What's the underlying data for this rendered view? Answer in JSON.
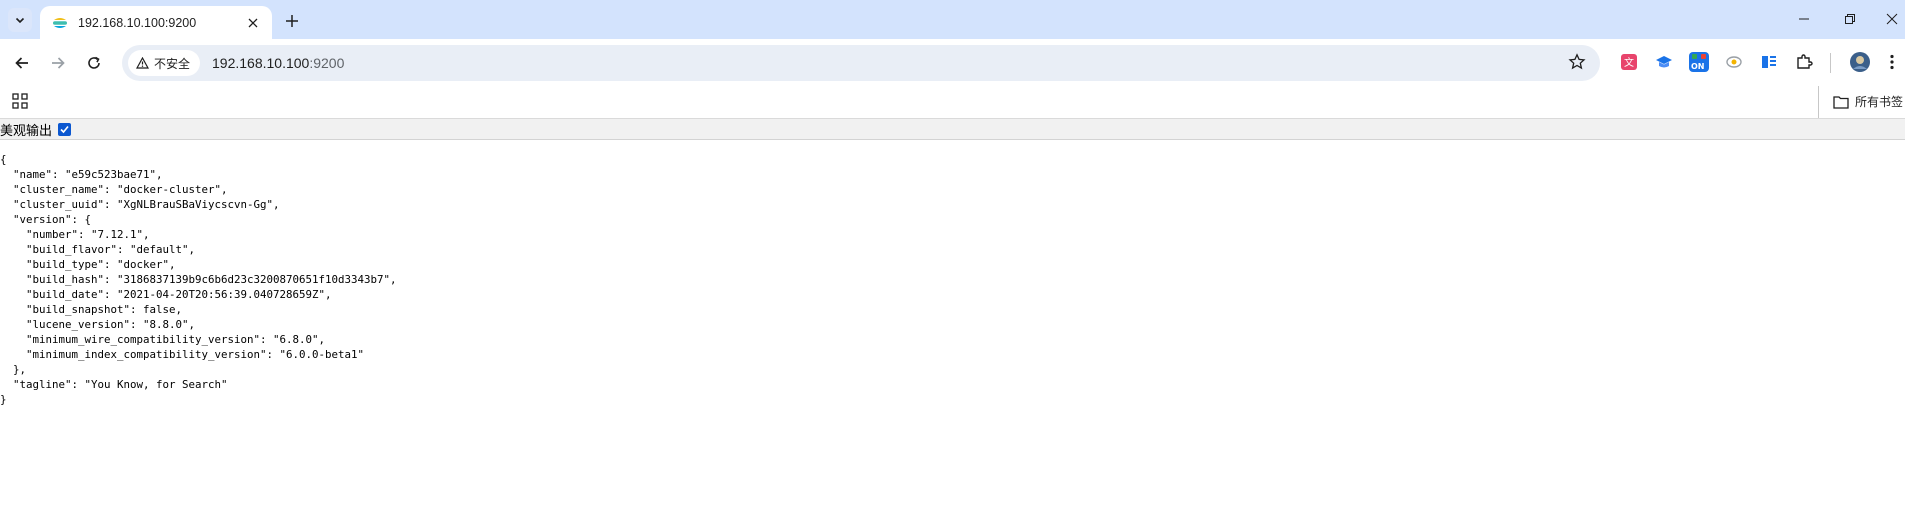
{
  "browser": {
    "tab": {
      "title": "192.168.10.100:9200"
    },
    "address": {
      "security_label": "不安全",
      "host": "192.168.10.100",
      "port": ":9200"
    },
    "bookmarks": {
      "all_label": "所有书签"
    }
  },
  "viewer": {
    "pretty_print_label": "美观输出",
    "pretty_print_checked": true
  },
  "json_lines": [
    "{",
    "  \"name\": \"e59c523bae71\",",
    "  \"cluster_name\": \"docker-cluster\",",
    "  \"cluster_uuid\": \"XgNLBrauSBaViycscvn-Gg\",",
    "  \"version\": {",
    "    \"number\": \"7.12.1\",",
    "    \"build_flavor\": \"default\",",
    "    \"build_type\": \"docker\",",
    "    \"build_hash\": \"3186837139b9c6b6d23c3200870651f10d3343b7\",",
    "    \"build_date\": \"2021-04-20T20:56:39.040728659Z\",",
    "    \"build_snapshot\": false,",
    "    \"lucene_version\": \"8.8.0\",",
    "    \"minimum_wire_compatibility_version\": \"6.8.0\",",
    "    \"minimum_index_compatibility_version\": \"6.0.0-beta1\"",
    "  },",
    "  \"tagline\": \"You Know, for Search\"",
    "}"
  ],
  "icons": {
    "tab_search": "chevron-down-icon",
    "favicon": "elasticsearch-icon",
    "close": "close-icon",
    "new_tab": "plus-icon",
    "back": "arrow-left-icon",
    "forward": "arrow-right-icon",
    "reload": "reload-icon",
    "warning": "warning-icon",
    "bookmark": "star-icon",
    "apps": "apps-grid-icon",
    "folder": "folder-icon"
  }
}
